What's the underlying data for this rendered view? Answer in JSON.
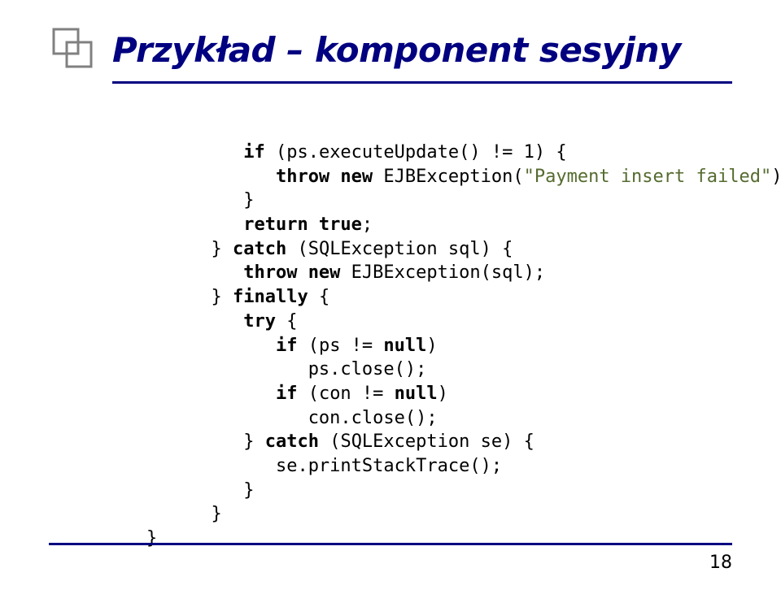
{
  "title": "Przykład – komponent sesyjny",
  "code": {
    "l1_if": "if",
    "l1_rest": " (ps.executeUpdate() != 1) {",
    "l2_throw_new": "throw new",
    "l2_mid": " EJBException(",
    "l2_str": "\"Payment insert failed\"",
    "l2_end": ");",
    "l3": "}",
    "l4_return_true": "return true",
    "l4_end": ";",
    "l5a": "} ",
    "l5_catch": "catch",
    "l5b": " (SQLException sql) {",
    "l6_throw_new": "throw new",
    "l6b": " EJBException(sql);",
    "l7a": "} ",
    "l7_finally": "finally",
    "l7b": " {",
    "l8_try": "try",
    "l8b": " {",
    "l9_if": "if",
    "l9a": " (ps != ",
    "l9_null": "null",
    "l9b": ")",
    "l10": "ps.close();",
    "l11_if": "if",
    "l11a": " (con != ",
    "l11_null": "null",
    "l11b": ")",
    "l12": "con.close();",
    "l13a": "} ",
    "l13_catch": "catch",
    "l13b": " (SQLException se) {",
    "l14": "se.printStackTrace();",
    "l15": "}",
    "l16": "}",
    "l17": "}"
  },
  "page_number": "18"
}
